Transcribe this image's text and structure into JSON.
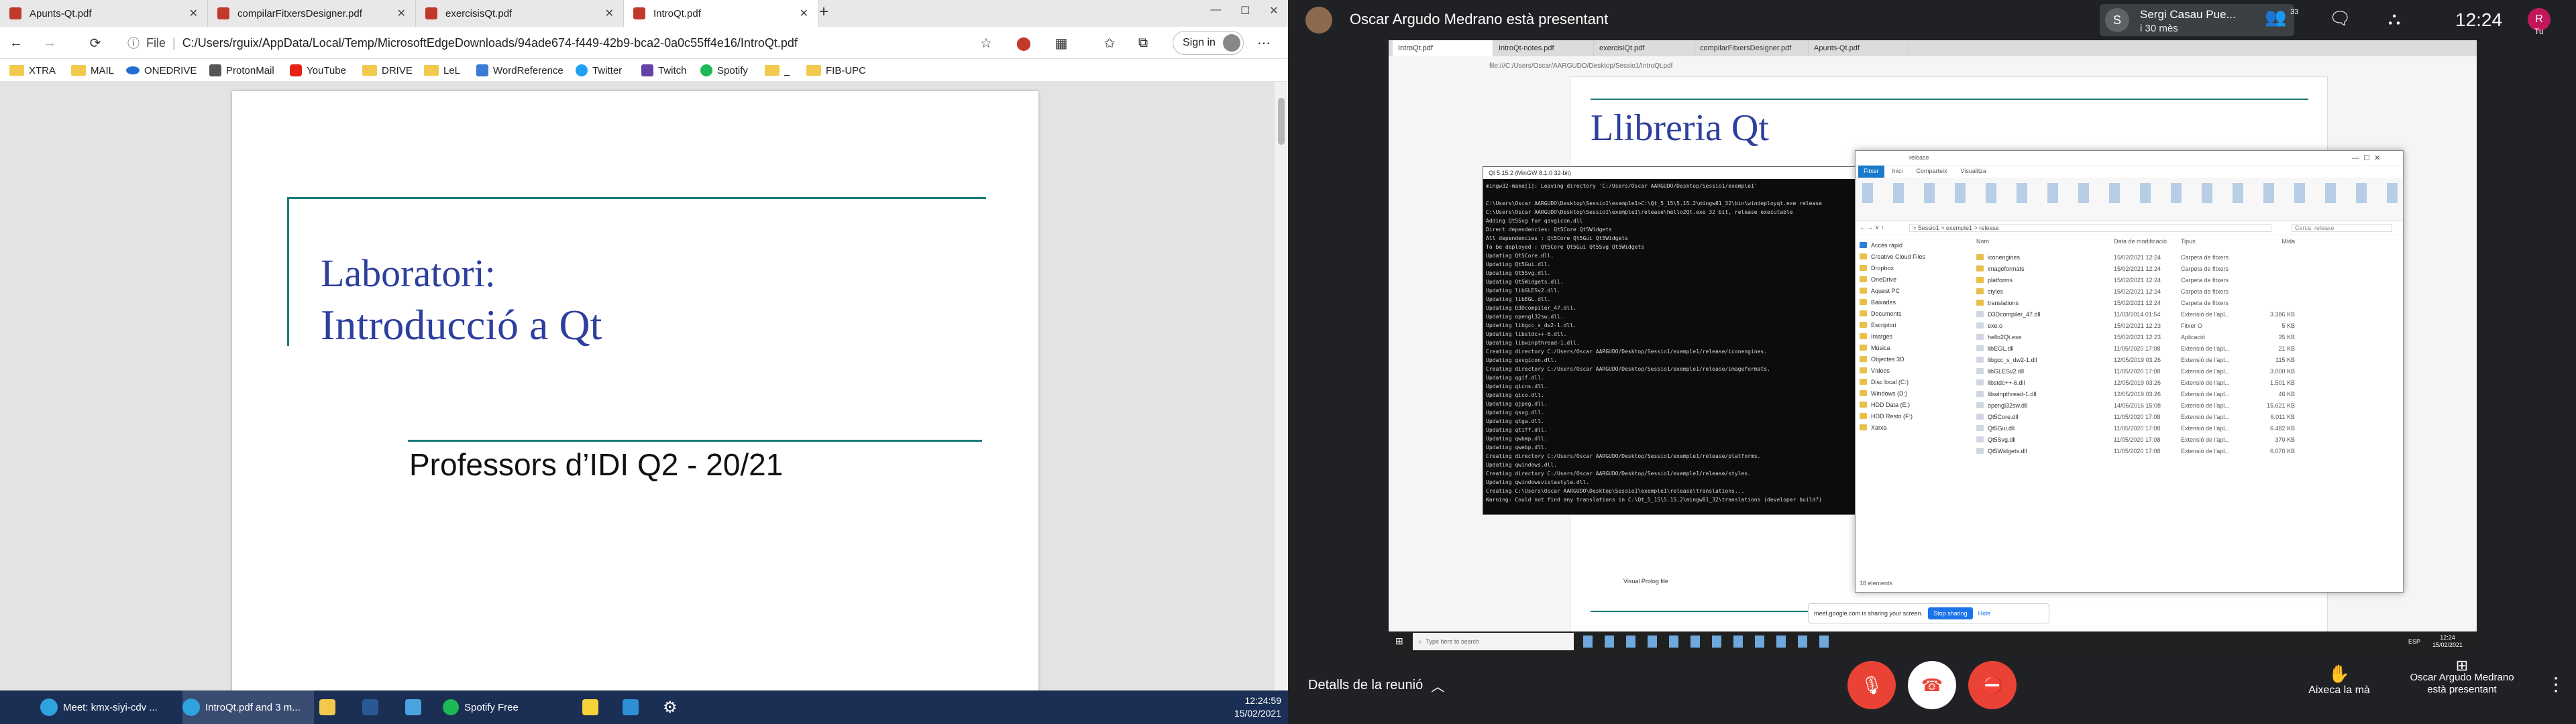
{
  "edge": {
    "tabs": [
      "Apunts-Qt.pdf",
      "compilarFitxersDesigner.pdf",
      "exercisisQt.pdf",
      "IntroQt.pdf"
    ],
    "address_prefix": "File",
    "address": "C:/Users/rguix/AppData/Local/Temp/MicrosoftEdgeDownloads/94ade674-f449-42b9-bca2-0a0c55ff4e16/IntroQt.pdf",
    "signin": "Sign in",
    "favorites": [
      "XTRA",
      "MAIL",
      "ONEDRIVE",
      "ProtonMail",
      "YouTube",
      "DRIVE",
      "LeL",
      "WordReference",
      "Twitter",
      "Twitch",
      "Spotify",
      "_",
      "FIB-UPC"
    ],
    "slide": {
      "title1": "Laboratori:",
      "title2": "Introducció a Qt",
      "subtitle": "Professors d’IDI Q2 - 20/21"
    }
  },
  "taskbar": {
    "meet": "Meet: kmx-siyi-cdv ...",
    "edge": "IntroQt.pdf and 3 m...",
    "spotify": "Spotify Free",
    "time": "12:24:59",
    "date": "15/02/2021"
  },
  "meet": {
    "presenter": "Oscar Argudo Medrano està presentant",
    "participant_initial": "S",
    "participant_name": "Sergi Casau Pue...",
    "participant_time": "i 30 mès",
    "participant_count": "33",
    "clock": "12:24",
    "you_label": "Tu",
    "avatar_initial": "R",
    "details": "Detalls de la reunió",
    "raise_hand": "Aixeca la mà",
    "presenting_line1": "Oscar Argudo Medrano",
    "presenting_line2": "està presentant"
  },
  "shared": {
    "tabs": [
      "IntroQt.pdf",
      "IntroQt-notes.pdf",
      "exercisiQt.pdf",
      "compilarFitxersDesigner.pdf",
      "Apunts-Qt.pdf"
    ],
    "address": "file:///C:/Users/Oscar/AARGUDO/Desktop/Sessio1/IntroQt.pdf",
    "slide_title": "Llibreria Qt",
    "terminal_title": "Qt 5.15.2 (MinGW 8.1.0 32-bit)",
    "terminal_lines": [
      "mingw32-make[1]: Leaving directory 'C:/Users/Oscar AARGUDO/Desktop/Sessio1/exemple1'",
      "",
      "C:\\Users\\Oscar AARGUDO\\Desktop\\Sessio1\\exemple1>C:\\Qt_5_15\\5.15.2\\mingw81_32\\bin\\windeployqt.exe release",
      "C:\\Users\\Oscar AARGUDO\\Desktop\\Sessio1\\exemple1\\release\\hello2Qt.exe 32 bit, release executable",
      "Adding Qt5Svg for qsvgicon.dll",
      "Direct dependencies: Qt5Core Qt5Widgets",
      "All dependencies   : Qt5Core Qt5Gui Qt5Widgets",
      "To be deployed     : Qt5Core Qt5Gui Qt5Svg Qt5Widgets",
      "Updating Qt5Core.dll.",
      "Updating Qt5Gui.dll.",
      "Updating Qt5Svg.dll.",
      "Updating Qt5Widgets.dll.",
      "Updating libGLESv2.dll.",
      "Updating libEGL.dll.",
      "Updating D3Dcompiler_47.dll.",
      "Updating opengl32sw.dll.",
      "Updating libgcc_s_dw2-1.dll.",
      "Updating libstdc++-6.dll.",
      "Updating libwinpthread-1.dll.",
      "Creating directory C:/Users/Oscar AARGUDO/Desktop/Sessio1/exemple1/release/iconengines.",
      "Updating qsvgicon.dll.",
      "Creating directory C:/Users/Oscar AARGUDO/Desktop/Sessio1/exemple1/release/imageformats.",
      "Updating qgif.dll.",
      "Updating qicns.dll.",
      "Updating qico.dll.",
      "Updating qjpeg.dll.",
      "Updating qsvg.dll.",
      "Updating qtga.dll.",
      "Updating qtiff.dll.",
      "Updating qwbmp.dll.",
      "Updating qwebp.dll.",
      "Creating directory C:/Users/Oscar AARGUDO/Desktop/Sessio1/exemple1/release/platforms.",
      "Updating qwindows.dll.",
      "Creating directory C:/Users/Oscar AARGUDO/Desktop/Sessio1/exemple1/release/styles.",
      "Updating qwindowsvistastyle.dll.",
      "Creating C:\\Users\\Oscar AARGUDO\\Desktop\\Sessio1\\exemple1\\release\\translations...",
      "Warning: Could not find any translations in C:\\Qt_5_15\\5.15.2\\mingw81_32\\translations (developer build?)",
      "",
      "C:\\Users\\Oscar AARGUDO\\Desktop\\Sessio1\\exemple1>"
    ],
    "explorer_title": "release",
    "explorer_ribbon": [
      "Fitxer",
      "Inici",
      "Comparteix",
      "Visualitza"
    ],
    "explorer_tools": [
      "Gestiona",
      "Aplicació"
    ],
    "explorer_path": "> Sessio1 > exemple1 > release",
    "explorer_search": "Cerca: release",
    "explorer_cols": [
      "Nom",
      "Data de modificació",
      "Tipus",
      "Mida"
    ],
    "explorer_nav": [
      "Accés ràpid",
      "Creative Cloud Files",
      "Dropbox",
      "OneDrive",
      "Aquest PC",
      "Baixades",
      "Documents",
      "Escriptori",
      "Imatges",
      "Música",
      "Objectes 3D",
      "Vídeos",
      "Disc local (C:)",
      "Windows (D:)",
      "HDD Data (E:)",
      "HDD Resto (F:)",
      "Xarxa"
    ],
    "explorer_files": [
      {
        "name": "iconengines",
        "date": "15/02/2021 12:24",
        "type": "Carpeta de fitxers",
        "size": ""
      },
      {
        "name": "imageformats",
        "date": "15/02/2021 12:24",
        "type": "Carpeta de fitxers",
        "size": ""
      },
      {
        "name": "platforms",
        "date": "15/02/2021 12:24",
        "type": "Carpeta de fitxers",
        "size": ""
      },
      {
        "name": "styles",
        "date": "15/02/2021 12:24",
        "type": "Carpeta de fitxers",
        "size": ""
      },
      {
        "name": "translations",
        "date": "15/02/2021 12:24",
        "type": "Carpeta de fitxers",
        "size": ""
      },
      {
        "name": "D3Dcompiler_47.dll",
        "date": "11/03/2014 01:54",
        "type": "Extensió de l'apl...",
        "size": "3.386 KB"
      },
      {
        "name": "exe.o",
        "date": "15/02/2021 12:23",
        "type": "Fitxer O",
        "size": "5 KB"
      },
      {
        "name": "hello2Qt.exe",
        "date": "15/02/2021 12:23",
        "type": "Aplicació",
        "size": "35 KB"
      },
      {
        "name": "libEGL.dll",
        "date": "11/05/2020 17:08",
        "type": "Extensió de l'apl...",
        "size": "21 KB"
      },
      {
        "name": "libgcc_s_dw2-1.dll",
        "date": "12/05/2019 03:26",
        "type": "Extensió de l'apl...",
        "size": "115 KB"
      },
      {
        "name": "libGLESv2.dll",
        "date": "11/05/2020 17:08",
        "type": "Extensió de l'apl...",
        "size": "3.000 KB"
      },
      {
        "name": "libstdc++-6.dll",
        "date": "12/05/2019 03:26",
        "type": "Extensió de l'apl...",
        "size": "1.501 KB"
      },
      {
        "name": "libwinpthread-1.dll",
        "date": "12/05/2019 03:26",
        "type": "Extensió de l'apl...",
        "size": "46 KB"
      },
      {
        "name": "opengl32sw.dll",
        "date": "14/06/2016 15:08",
        "type": "Extensió de l'apl...",
        "size": "15.621 KB"
      },
      {
        "name": "Qt5Core.dll",
        "date": "11/05/2020 17:08",
        "type": "Extensió de l'apl...",
        "size": "6.011 KB"
      },
      {
        "name": "Qt5Gui.dll",
        "date": "11/05/2020 17:08",
        "type": "Extensió de l'apl...",
        "size": "6.482 KB"
      },
      {
        "name": "Qt5Svg.dll",
        "date": "11/05/2020 17:08",
        "type": "Extensió de l'apl...",
        "size": "370 KB"
      },
      {
        "name": "Qt5Widgets.dll",
        "date": "11/05/2020 17:08",
        "type": "Extensió de l'apl...",
        "size": "6.070 KB"
      }
    ],
    "explorer_count": "18 elements",
    "sharing_notice": "meet.google.com is sharing your screen.",
    "stop_sharing": "Stop sharing",
    "hide": "Hide",
    "search_placeholder": "Type here to search",
    "tray_lang": "ESP",
    "tray_time": "12:24",
    "tray_date": "15/02/2021",
    "behind_label": "Visual Prolog file"
  },
  "colors": {
    "meet_bg": "#202124",
    "slide_blue": "#2e3f9e",
    "slide_teal": "#1a7a79",
    "hangup": "#ea4335"
  }
}
